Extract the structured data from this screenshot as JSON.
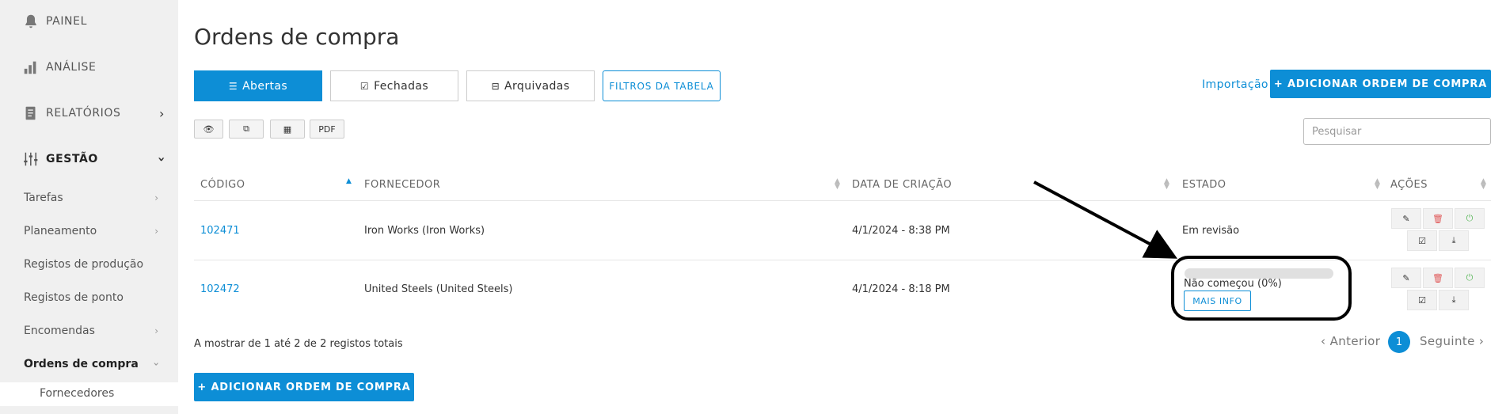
{
  "sidebar": {
    "main_items": [
      {
        "label": "PAINEL",
        "icon": "bell-icon"
      },
      {
        "label": "ANÁLISE",
        "icon": "bar-chart-icon"
      },
      {
        "label": "RELATÓRIOS",
        "icon": "document-icon"
      },
      {
        "label": "GESTÃO",
        "icon": "sliders-icon"
      }
    ],
    "sub_items": [
      {
        "label": "Tarefas"
      },
      {
        "label": "Planeamento"
      },
      {
        "label": "Registos de produção"
      },
      {
        "label": "Registos de ponto"
      },
      {
        "label": "Encomendas"
      },
      {
        "label": "Ordens de compra"
      }
    ],
    "deep_item": "Fornecedores"
  },
  "page": {
    "title": "Ordens de compra",
    "tabs": [
      {
        "label": "Abertas",
        "icon": "list-icon",
        "active": true
      },
      {
        "label": "Fechadas",
        "icon": "check-square-icon",
        "active": false
      },
      {
        "label": "Arquivadas",
        "icon": "inbox-icon",
        "active": false
      }
    ],
    "filters_label": "FILTROS DA TABELA",
    "import_label": "Importação",
    "add_label": "+ ADICIONAR ORDEM DE COMPRA",
    "tools": {
      "pdf_label": "PDF"
    },
    "search_placeholder": "Pesquisar"
  },
  "table": {
    "columns": [
      "CÓDIGO",
      "FORNECEDOR",
      "DATA DE CRIAÇÃO",
      "ESTADO",
      "AÇÕES"
    ],
    "rows": [
      {
        "code": "102471",
        "supplier": "Iron Works (Iron Works)",
        "created": "4/1/2024 - 8:38 PM",
        "status": "Em revisão"
      },
      {
        "code": "102472",
        "supplier": "United Steels (United Steels)",
        "created": "4/1/2024 - 8:18 PM",
        "status": "Não começou (0%)",
        "progress": 0,
        "info_label": "MAIS INFO"
      }
    ]
  },
  "footer": {
    "info": "A mostrar de 1 até 2 de 2 registos totais",
    "prev_label": "‹ Anterior",
    "current_page": "1",
    "next_label": "Seguinte ›"
  },
  "colors": {
    "accent": "#0d8ed6",
    "danger": "#e05a5a",
    "success": "#5cb85c"
  }
}
